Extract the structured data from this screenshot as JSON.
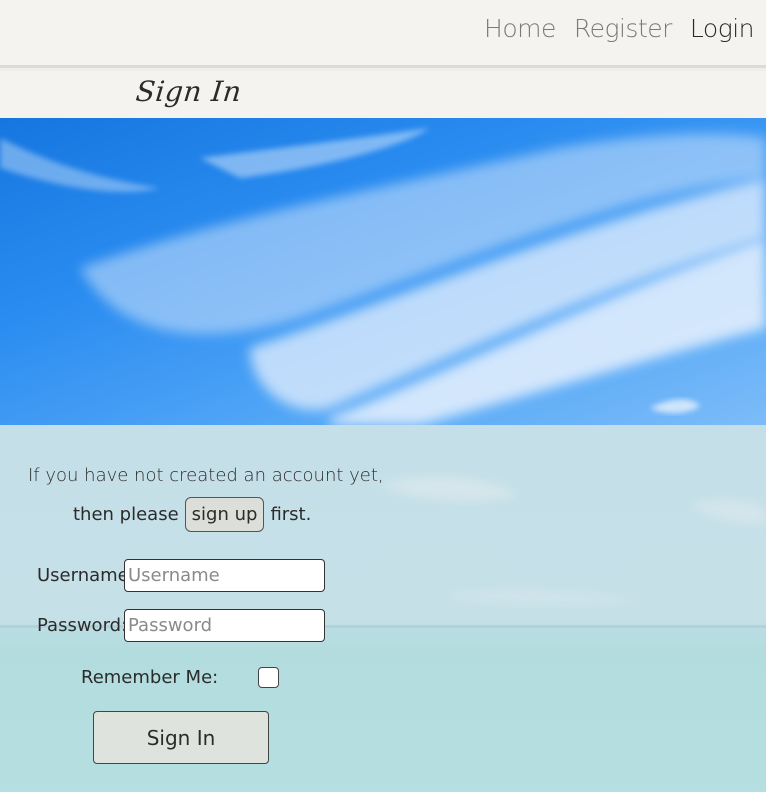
{
  "nav": {
    "items": [
      {
        "label": "Home",
        "active": false
      },
      {
        "label": "Register",
        "active": false
      },
      {
        "label": "Login",
        "active": true
      }
    ]
  },
  "page": {
    "title": "Sign In"
  },
  "intro": {
    "line1": "If you have not created an account yet,",
    "line2_before": "then please",
    "signup_label": "sign up",
    "line2_after": "first."
  },
  "form": {
    "username": {
      "label": "Username:",
      "placeholder": "Username",
      "value": ""
    },
    "password": {
      "label": "Password:",
      "placeholder": "Password",
      "value": ""
    },
    "remember_label": "Remember Me:",
    "remember_checked": false,
    "submit_label": "Sign In"
  },
  "colors": {
    "sky": "#2a8cf0",
    "sea": "#c6e0e8",
    "nav_background": "#f4f3ef",
    "active_link": "#2a2a2a",
    "inactive_link": "#7a7a78"
  }
}
